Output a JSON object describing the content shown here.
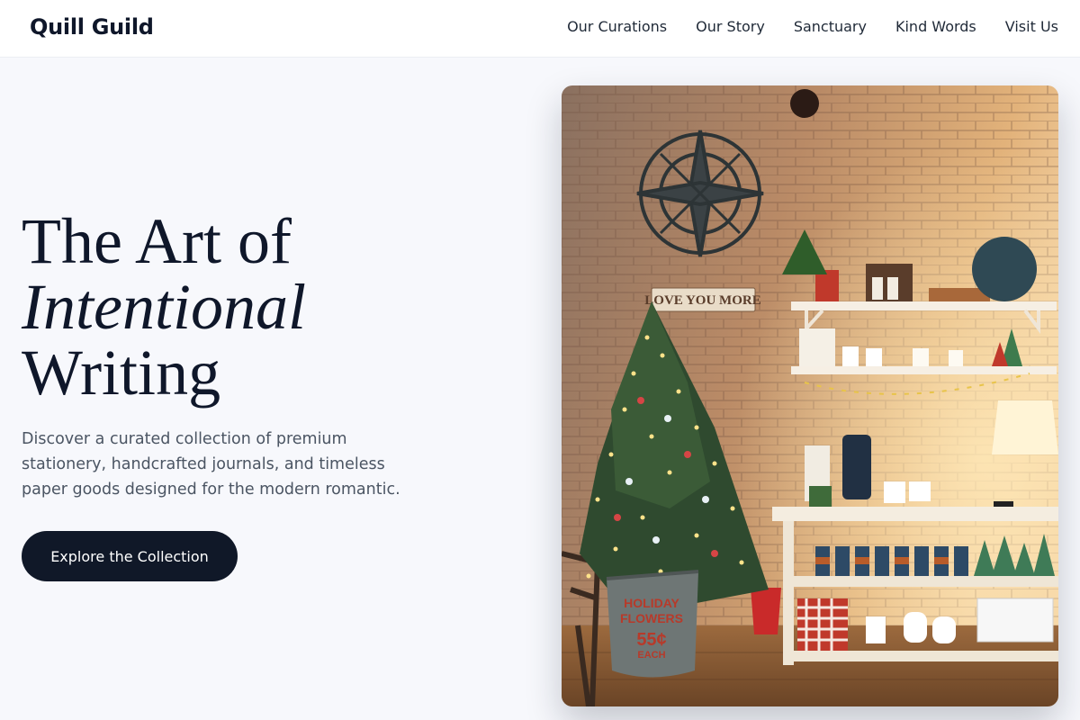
{
  "brand": {
    "name": "Quill Guild"
  },
  "nav": {
    "items": [
      {
        "label": "Our Curations"
      },
      {
        "label": "Our Story"
      },
      {
        "label": "Sanctuary"
      },
      {
        "label": "Kind Words"
      },
      {
        "label": "Visit Us"
      }
    ]
  },
  "hero": {
    "title_line1": "The Art of",
    "title_line2": "Intentional",
    "title_line3": "Writing",
    "subtitle": "Discover a curated collection of premium stationery, handcrafted journals, and timeless paper goods designed for the modern romantic.",
    "cta_label": "Explore the Collection"
  },
  "photo": {
    "sign_text": "LOVE YOU MORE",
    "bucket_line1": "HOLIDAY",
    "bucket_line2": "FLOWERS",
    "bucket_line3": "55¢",
    "bucket_line4": "EACH"
  },
  "colors": {
    "primary": "#101828",
    "text": "#0f172a",
    "muted": "#4b5563",
    "background": "#f7f8fc"
  }
}
